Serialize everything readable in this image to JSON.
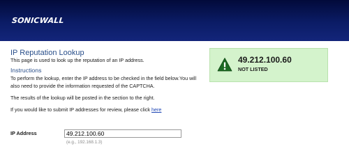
{
  "header": {
    "logo_text": "SONICWALL"
  },
  "lookup": {
    "title": "IP Reputation Lookup",
    "subtitle": "This page is used to look up the reputation of an IP address.",
    "instructions_heading": "Instructions",
    "instructions_text": "To perform the lookup, enter the IP address to be checked in the field below.You will also need to provide the information requested of the CAPTCHA.",
    "results_note": "The results of the lookup will be posted in the section to the right.",
    "submit_note_prefix": "If you would like to submit IP addresses for review, please click ",
    "submit_link_label": "here"
  },
  "form": {
    "ip_label": "IP Address",
    "ip_value": "49.212.100.60",
    "ip_example": "(e.g., 192.168.1.3)"
  },
  "result": {
    "ip": "49.212.100.60",
    "status": "NOT LISTED",
    "icon": "warning-icon",
    "background_color": "#d4f3cc",
    "icon_color": "#1d6a23"
  }
}
